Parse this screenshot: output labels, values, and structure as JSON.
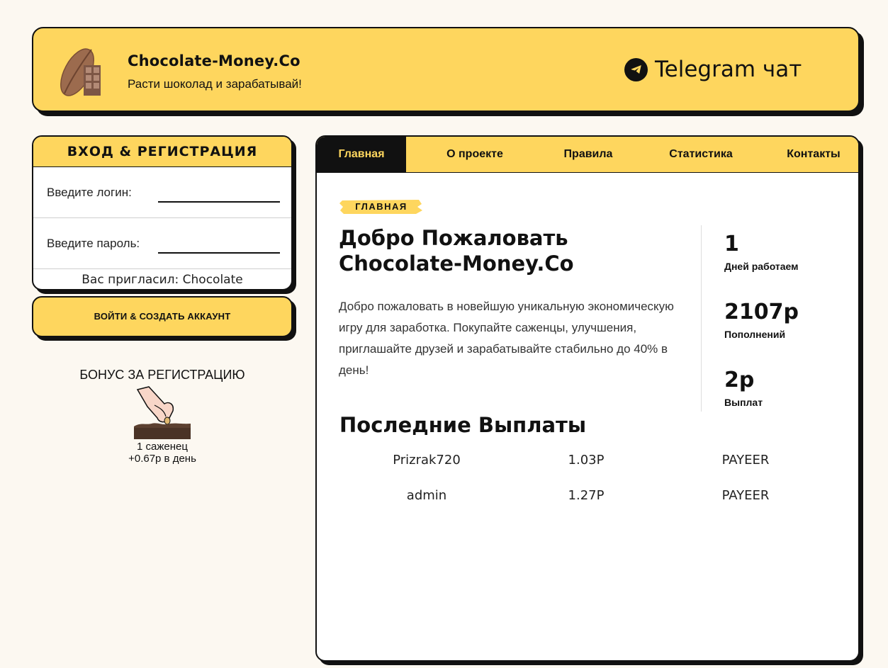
{
  "header": {
    "title": "Chocolate-Money.Co",
    "subtitle": "Расти шоколад и зарабатывай!",
    "telegram_label": "Telegram чат"
  },
  "login": {
    "heading": "ВХОД & РЕГИСТРАЦИЯ",
    "login_label": "Введите логин:",
    "login_value": "",
    "password_label": "Введите пароль:",
    "password_value": "",
    "invited_text": "Вас пригласил: Chocolate",
    "submit_label": "ВОЙТИ & СОЗДАТЬ АККАУНТ"
  },
  "bonus": {
    "title": "БОНУС ЗА РЕГИСТРАЦИЮ",
    "count": "1 саженец",
    "rate": "+0.67р в день"
  },
  "nav": {
    "tabs": [
      {
        "label": "Главная",
        "active": true
      },
      {
        "label": "О проекте",
        "active": false
      },
      {
        "label": "Правила",
        "active": false
      },
      {
        "label": "Статистика",
        "active": false
      },
      {
        "label": "Контакты",
        "active": false
      }
    ]
  },
  "main": {
    "badge": "ГЛАВНАЯ",
    "welcome_line1": "Добро Пожаловать",
    "welcome_line2": "Chocolate-Money.Co",
    "description": "Добро пожаловать в новейшую уникальную экономическую игру для заработка. Покупайте саженцы, улучшения, приглашайте друзей и зарабатывайте стабильно до 40% в день!",
    "stats": [
      {
        "value": "1",
        "label": "Дней работаем"
      },
      {
        "value": "2107р",
        "label": "Пополнений"
      },
      {
        "value": "2р",
        "label": "Выплат"
      }
    ],
    "payouts_title": "Последние Выплаты",
    "payouts": [
      {
        "user": "Prizrak720",
        "amount": "1.03Р",
        "system": "PAYEER"
      },
      {
        "user": "admin",
        "amount": "1.27Р",
        "system": "PAYEER"
      }
    ]
  },
  "colors": {
    "accent": "#fed65e",
    "dark": "#111111",
    "background": "#fcf8f1"
  },
  "icons": {
    "logo": "cocoa-bean-chocolate-icon",
    "telegram": "telegram-icon",
    "bonus": "hand-planting-seed-icon"
  }
}
